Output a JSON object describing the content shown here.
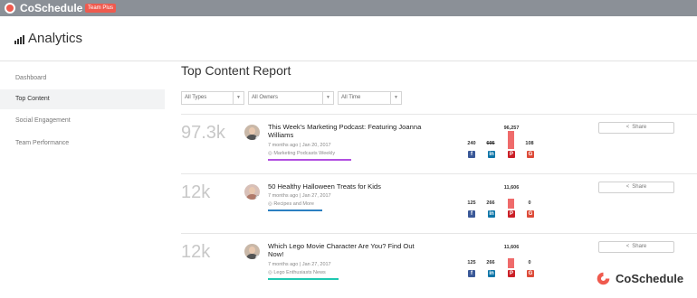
{
  "app": {
    "brand": "CoSchedule",
    "plan_badge": "Team Plus",
    "logo_color": "#ef5a4e"
  },
  "header": {
    "title": "Analytics",
    "icon": "bar-chart-icon"
  },
  "sidebar": {
    "items": [
      {
        "label": "Dashboard",
        "active": false
      },
      {
        "label": "Top Content",
        "active": true
      },
      {
        "label": "Social Engagement",
        "active": false
      },
      {
        "label": "Team Performance",
        "active": false
      }
    ]
  },
  "report": {
    "title": "Top Content Report",
    "filters": [
      {
        "value": "All Types"
      },
      {
        "value": "All Owners"
      },
      {
        "value": "All Time"
      }
    ],
    "share_label": "Share",
    "rows": [
      {
        "score": "97.3k",
        "headline": "This Week's Marketing Podcast: Featuring Joanna Williams",
        "meta": "7 months ago | Jan 20, 2017",
        "tag": "Marketing Podcasts Weekly",
        "tag_color": "#b14fe0",
        "stats": {
          "facebook": "240",
          "linkedin": "695",
          "pinterest": "96,257",
          "google": "108"
        },
        "pinterest_level": 1.0
      },
      {
        "score": "12k",
        "headline": "50 Healthy Halloween Treats for Kids",
        "meta": "7 months ago | Jan 27, 2017",
        "tag": "Recipes and More",
        "tag_color": "#2b7fc1",
        "stats": {
          "facebook": "125",
          "linkedin": "266",
          "pinterest": "11,606",
          "google": "0"
        },
        "pinterest_level": 0.55
      },
      {
        "score": "12k",
        "headline": "Which Lego Movie Character Are You? Find Out Now!",
        "meta": "7 months ago | Jan 27, 2017",
        "tag": "Lego Enthusiasts News",
        "tag_color": "#1fc8b0",
        "stats": {
          "facebook": "125",
          "linkedin": "266",
          "pinterest": "11,606",
          "google": "0"
        },
        "pinterest_level": 0.55
      }
    ]
  },
  "footer_logo": {
    "word": "CoSchedule"
  }
}
